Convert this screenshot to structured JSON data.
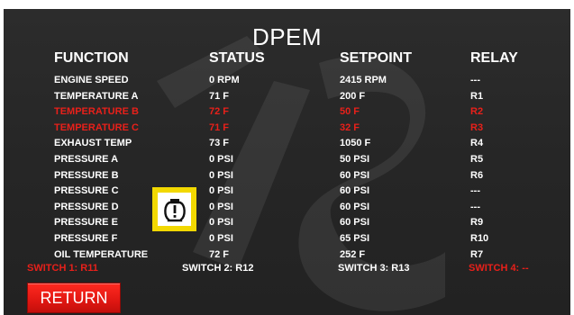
{
  "title": "DPEM",
  "headers": {
    "function": "FUNCTION",
    "status": "STATUS",
    "setpoint": "SETPOINT",
    "relay": "RELAY"
  },
  "rows": [
    {
      "function": "ENGINE SPEED",
      "status": "0 RPM",
      "setpoint": "2415 RPM",
      "relay": "---",
      "alarm": false
    },
    {
      "function": "TEMPERATURE A",
      "status": "71 F",
      "setpoint": "200 F",
      "relay": "R1",
      "alarm": false
    },
    {
      "function": "TEMPERATURE B",
      "status": "72 F",
      "setpoint": "50 F",
      "relay": "R2",
      "alarm": true
    },
    {
      "function": "TEMPERATURE C",
      "status": "71 F",
      "setpoint": "32 F",
      "relay": "R3",
      "alarm": true
    },
    {
      "function": "EXHAUST TEMP",
      "status": "73 F",
      "setpoint": "1050 F",
      "relay": "R4",
      "alarm": false
    },
    {
      "function": "PRESSURE A",
      "status": "0 PSI",
      "setpoint": "50 PSI",
      "relay": "R5",
      "alarm": false
    },
    {
      "function": "PRESSURE B",
      "status": "0 PSI",
      "setpoint": "60 PSI",
      "relay": "R6",
      "alarm": false
    },
    {
      "function": "PRESSURE C",
      "status": "0 PSI",
      "setpoint": "60 PSI",
      "relay": "---",
      "alarm": false
    },
    {
      "function": "PRESSURE D",
      "status": "0 PSI",
      "setpoint": "60 PSI",
      "relay": "---",
      "alarm": false
    },
    {
      "function": "PRESSURE E",
      "status": "0 PSI",
      "setpoint": "60 PSI",
      "relay": "R9",
      "alarm": false
    },
    {
      "function": "PRESSURE F",
      "status": "0 PSI",
      "setpoint": "65 PSI",
      "relay": "R10",
      "alarm": false
    },
    {
      "function": "OIL TEMPERATURE",
      "status": "72 F",
      "setpoint": "252 F",
      "relay": "R7",
      "alarm": false
    }
  ],
  "switches": [
    {
      "label": "SWITCH 1:  R11",
      "alarm": true
    },
    {
      "label": "SWITCH 2:  R12",
      "alarm": false
    },
    {
      "label": "SWITCH 3:  R13",
      "alarm": false
    },
    {
      "label": "SWITCH 4:  --",
      "alarm": true
    }
  ],
  "return_label": "RETURN",
  "colors": {
    "alarm": "#e8201a",
    "text": "#ffffff",
    "background": "#262626",
    "warning": "#f2d800"
  },
  "icons": {
    "warning": "engine-warning-icon"
  }
}
